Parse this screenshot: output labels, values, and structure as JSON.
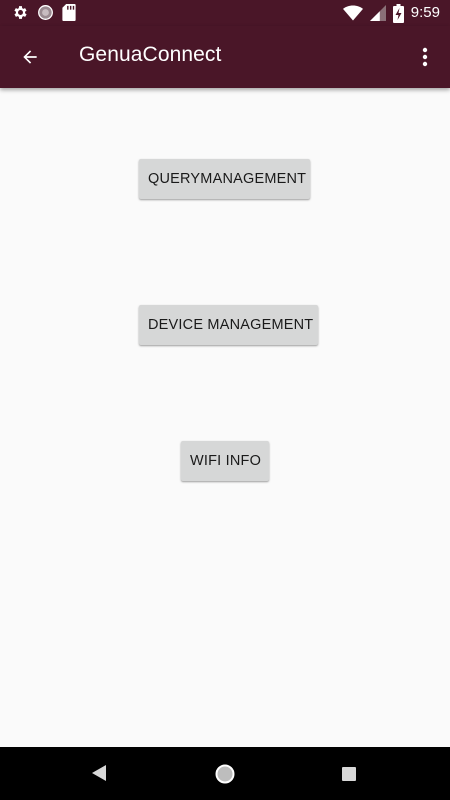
{
  "status_bar": {
    "time": "9:59",
    "left_icons": [
      "settings-icon",
      "circle-icon",
      "sd-card-icon"
    ],
    "right_icons": [
      "wifi-icon",
      "signal-icon",
      "battery-charging-icon"
    ]
  },
  "app_bar": {
    "title": "GenuaConnect",
    "back_icon": "arrow-back-icon",
    "menu_icon": "more-vert-icon",
    "color": "#4a1628"
  },
  "buttons": {
    "query_management": "QUERYMANAGEMENT",
    "device_management": "DEVICE MANAGEMENT",
    "wifi_info": "WIFI INFO"
  },
  "nav_bar": {
    "icons": [
      "nav-back-icon",
      "nav-home-icon",
      "nav-recents-icon"
    ]
  },
  "colors": {
    "primary_dark": "#4a1628",
    "background": "#fafafa",
    "button": "#d6d7d7"
  }
}
